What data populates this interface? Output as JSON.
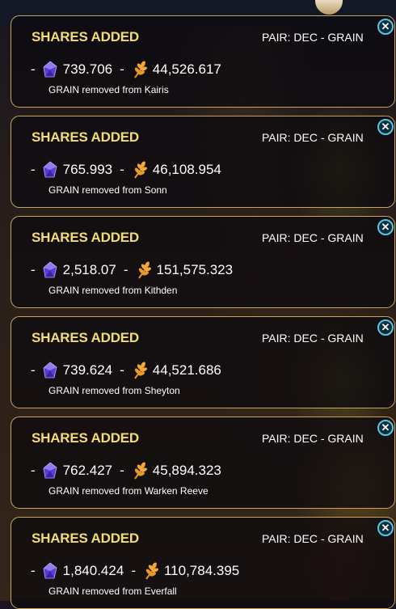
{
  "colors": {
    "title": "#f3dc73",
    "border": "#c9a55b",
    "close_ring": "#57c5e6"
  },
  "icons": {
    "dec": "purple-crystal-icon",
    "grain": "wheat-icon",
    "close": "close-icon"
  },
  "toasts": [
    {
      "title": "SHARES ADDED",
      "pair": "PAIR: DEC - GRAIN",
      "dec_amount": "739.706",
      "grain_amount": "44,526.617",
      "message": "GRAIN removed from Kairis"
    },
    {
      "title": "SHARES ADDED",
      "pair": "PAIR: DEC - GRAIN",
      "dec_amount": "765.993",
      "grain_amount": "46,108.954",
      "message": "GRAIN removed from Sonn"
    },
    {
      "title": "SHARES ADDED",
      "pair": "PAIR: DEC - GRAIN",
      "dec_amount": "2,518.07",
      "grain_amount": "151,575.323",
      "message": "GRAIN removed from Kithden"
    },
    {
      "title": "SHARES ADDED",
      "pair": "PAIR: DEC - GRAIN",
      "dec_amount": "739.624",
      "grain_amount": "44,521.686",
      "message": "GRAIN removed from Sheyton"
    },
    {
      "title": "SHARES ADDED",
      "pair": "PAIR: DEC - GRAIN",
      "dec_amount": "762.427",
      "grain_amount": "45,894.323",
      "message": "GRAIN removed from Warken Reeve"
    },
    {
      "title": "SHARES ADDED",
      "pair": "PAIR: DEC - GRAIN",
      "dec_amount": "1,840.424",
      "grain_amount": "110,784.395",
      "message": "GRAIN removed from Everfall"
    }
  ]
}
